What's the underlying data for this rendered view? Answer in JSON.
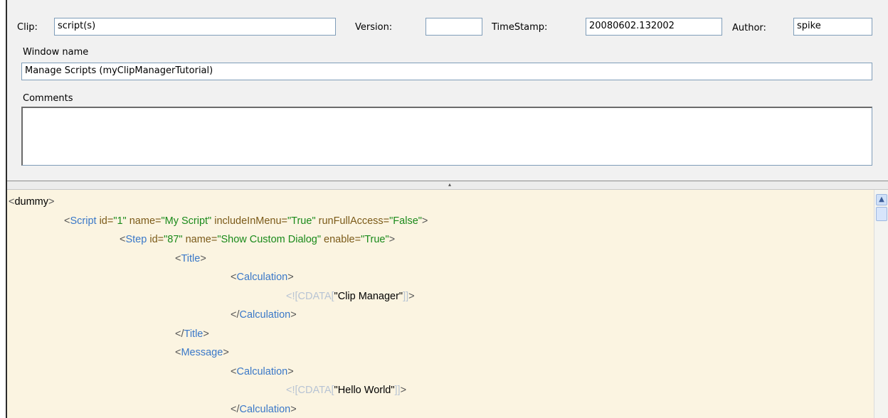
{
  "header": {
    "clip_label": "Clip:",
    "clip_value": "script(s)",
    "version_label": "Version:",
    "version_value": "",
    "timestamp_label": "TimeStamp:",
    "timestamp_value": "20080602.132002",
    "author_label": "Author:",
    "author_value": "spike",
    "window_name_label": "Window name",
    "window_name_value": "Manage Scripts (myClipManagerTutorial)",
    "comments_label": "Comments",
    "comments_value": ""
  },
  "editor": {
    "lines": [
      {
        "indent": 0,
        "parts": [
          [
            "br",
            "<"
          ],
          [
            "txt",
            "dummy"
          ],
          [
            "br",
            ">"
          ]
        ]
      },
      {
        "indent": 1,
        "parts": [
          [
            "br",
            "<"
          ],
          [
            "tag",
            "Script"
          ],
          [
            "attr",
            " id="
          ],
          [
            "val",
            "\"1\""
          ],
          [
            "attr",
            " name="
          ],
          [
            "val",
            "\"My Script\""
          ],
          [
            "attr",
            " includeInMenu="
          ],
          [
            "val",
            "\"True\""
          ],
          [
            "attr",
            " runFullAccess="
          ],
          [
            "val",
            "\"False\""
          ],
          [
            "br",
            ">"
          ]
        ]
      },
      {
        "indent": 2,
        "parts": [
          [
            "br",
            "<"
          ],
          [
            "tag",
            "Step"
          ],
          [
            "attr",
            " id="
          ],
          [
            "val",
            "\"87\""
          ],
          [
            "attr",
            " name="
          ],
          [
            "val",
            "\"Show Custom Dialog\""
          ],
          [
            "attr",
            " enable="
          ],
          [
            "val",
            "\"True\""
          ],
          [
            "br",
            ">"
          ]
        ]
      },
      {
        "indent": 3,
        "parts": [
          [
            "br",
            "<"
          ],
          [
            "tag",
            "Title"
          ],
          [
            "br",
            ">"
          ]
        ]
      },
      {
        "indent": 4,
        "parts": [
          [
            "br",
            "<"
          ],
          [
            "tag",
            "Calculation"
          ],
          [
            "br",
            ">"
          ]
        ]
      },
      {
        "indent": 5,
        "parts": [
          [
            "cd",
            "<![CDATA["
          ],
          [
            "txt",
            "\"Clip Manager\""
          ],
          [
            "cd",
            "]]"
          ],
          [
            "br",
            ">"
          ]
        ]
      },
      {
        "indent": 4,
        "parts": [
          [
            "br",
            "</"
          ],
          [
            "tag",
            "Calculation"
          ],
          [
            "br",
            ">"
          ]
        ]
      },
      {
        "indent": 3,
        "parts": [
          [
            "br",
            "</"
          ],
          [
            "tag",
            "Title"
          ],
          [
            "br",
            ">"
          ]
        ]
      },
      {
        "indent": 3,
        "parts": [
          [
            "br",
            "<"
          ],
          [
            "tag",
            "Message"
          ],
          [
            "br",
            ">"
          ]
        ]
      },
      {
        "indent": 4,
        "parts": [
          [
            "br",
            "<"
          ],
          [
            "tag",
            "Calculation"
          ],
          [
            "br",
            ">"
          ]
        ]
      },
      {
        "indent": 5,
        "parts": [
          [
            "cd",
            "<![CDATA["
          ],
          [
            "txt",
            "\"Hello World\""
          ],
          [
            "cd",
            "]]"
          ],
          [
            "br",
            ">"
          ]
        ]
      },
      {
        "indent": 4,
        "parts": [
          [
            "br",
            "</"
          ],
          [
            "tag",
            "Calculation"
          ],
          [
            "br",
            ">"
          ]
        ]
      }
    ]
  },
  "icons": {
    "splitter_grip": "splitter-grip-icon",
    "scroll_up": "scroll-up-arrow-icon"
  },
  "colors": {
    "editor_background": "#fbf4e1",
    "panel_background": "#f1f1f1",
    "tag": "#3a78c8",
    "attribute": "#7b5a18",
    "value": "#1a8a1a"
  }
}
